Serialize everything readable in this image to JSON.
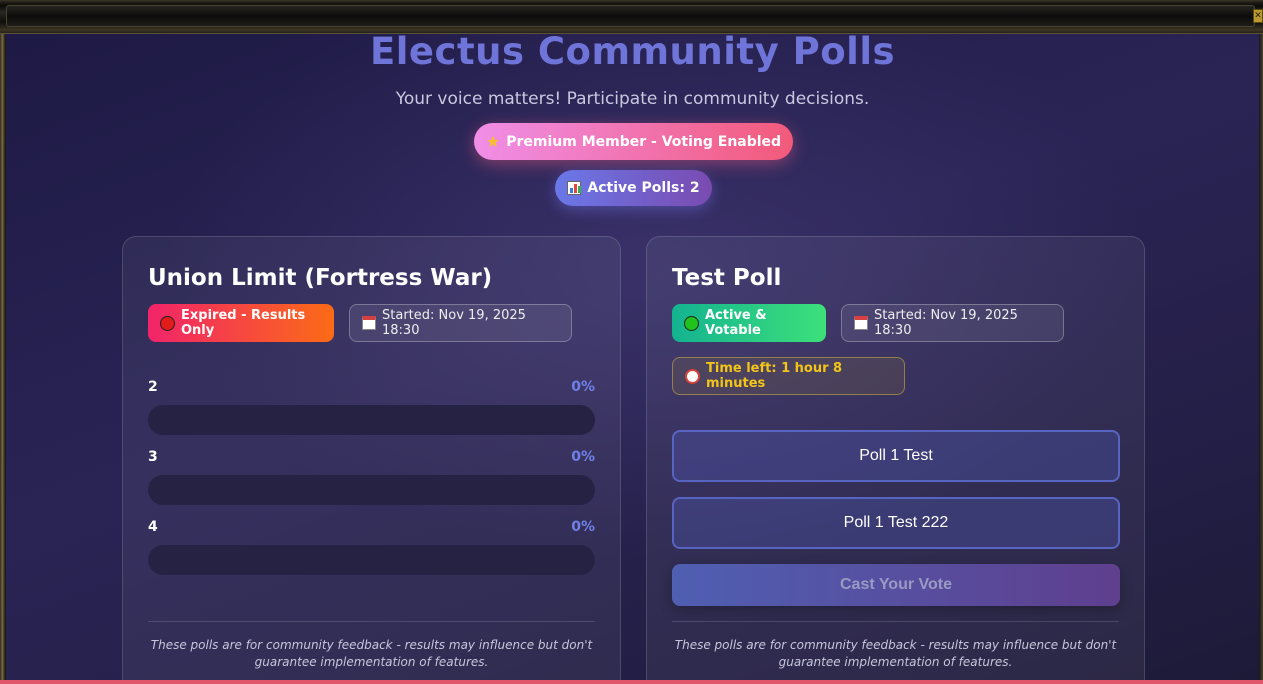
{
  "header": {
    "title": "Electus Community Polls",
    "subtitle": "Your voice matters! Participate in community decisions.",
    "premium_badge": "Premium Member - Voting Enabled",
    "active_polls_label": "Active Polls: 2"
  },
  "polls": [
    {
      "title": "Union Limit (Fortress War)",
      "status": "Expired - Results Only",
      "started": "Started: Nov 19, 2025 18:30",
      "options": [
        {
          "label": "2",
          "percent": "0%",
          "fill": 0
        },
        {
          "label": "3",
          "percent": "0%",
          "fill": 0
        },
        {
          "label": "4",
          "percent": "0%",
          "fill": 0
        }
      ],
      "footnote": "These polls are for community feedback - results may influence but don't guarantee implementation of features."
    },
    {
      "title": "Test Poll",
      "status": "Active & Votable",
      "started": "Started: Nov 19, 2025 18:30",
      "time_left": "Time left: 1 hour 8 minutes",
      "options": [
        {
          "label": "Poll 1 Test"
        },
        {
          "label": "Poll 1 Test 222"
        }
      ],
      "cast_button": "Cast Your Vote",
      "footnote": "These polls are for community feedback - results may influence but don't guarantee implementation of features."
    }
  ],
  "icons": {
    "expired": "red-circle-icon",
    "active": "green-circle-icon",
    "calendar": "calendar-icon",
    "clock": "alarm-clock-icon",
    "star": "star-icon",
    "chart": "bar-chart-icon"
  },
  "colors": {
    "title": "#6f74d8",
    "percent": "#6f80e8",
    "time_left": "#f2c518"
  }
}
